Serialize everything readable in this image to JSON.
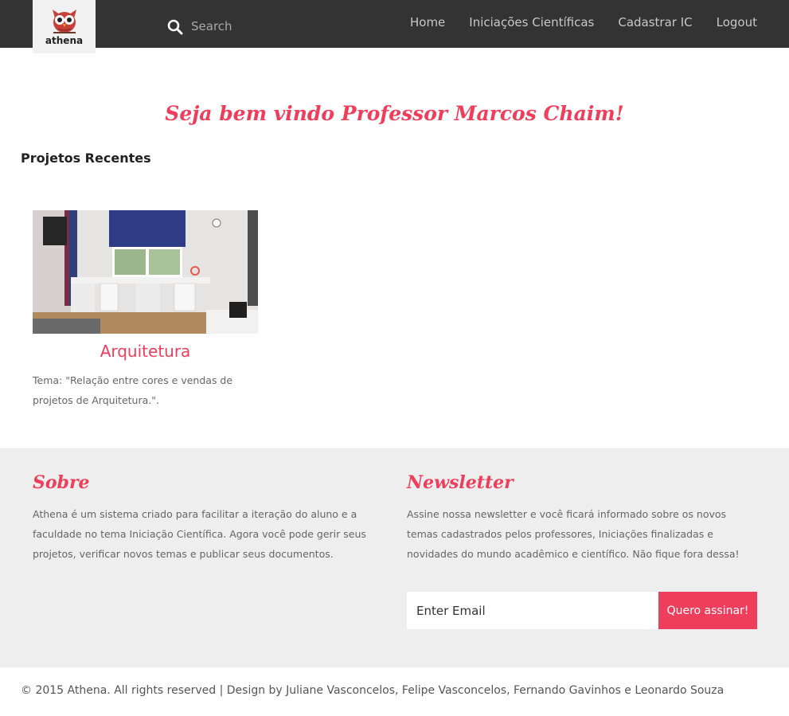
{
  "brand": {
    "name": "athena",
    "logo_icon": "owl-icon",
    "accent_color": "#ef3e5b"
  },
  "search": {
    "placeholder": "Search"
  },
  "nav": {
    "items": [
      {
        "label": "Home"
      },
      {
        "label": "Iniciações Científicas"
      },
      {
        "label": "Cadastrar IC"
      },
      {
        "label": "Logout"
      }
    ]
  },
  "main": {
    "welcome": "Seja bem vindo Professor Marcos Chaim!",
    "section_title": "Projetos Recentes",
    "projects": [
      {
        "title": "Arquitetura",
        "description": "Tema: \"Relação entre cores e vendas de projetos de Arquitetura.\"."
      }
    ]
  },
  "footer": {
    "about": {
      "heading": "Sobre",
      "text": "Athena é um sistema criado para facilitar a iteração do aluno e a faculdade no tema Iniciação Científica. Agora você pode gerir seus projetos, verificar novos temas e publicar seus documentos."
    },
    "newsletter": {
      "heading": "Newsletter",
      "text": "Assine nossa newsletter e você ficará informado sobre os novos temas cadastrados pelos professores, Iniciações finalizadas e novidades do mundo acadêmico e científico. Não fique fora dessa!",
      "email_placeholder": "Enter Email",
      "button_label": "Quero assinar!"
    },
    "copyright": "© 2015 Athena. All rights reserved | Design by Juliane Vasconcelos, Felipe Vasconcelos, Fernando Gavinhos e Leonardo Souza"
  }
}
